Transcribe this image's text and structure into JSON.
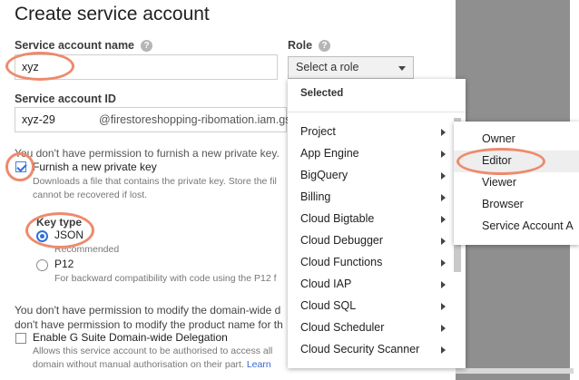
{
  "dialog": {
    "title": "Create service account",
    "service_account_name": {
      "label": "Service account name",
      "value": "xyz"
    },
    "role": {
      "label": "Role",
      "select_value": "Select a role"
    },
    "service_account_id": {
      "label": "Service account ID",
      "value": "xyz-29",
      "domain": "@firestoreshopping-ribomation.iam.gs"
    },
    "private_key_warning": "You don't have permission to furnish a new private key.",
    "furnish_key": {
      "label": "Furnish a new private key",
      "checked": true,
      "desc_line1": "Downloads a file that contains the private key. Store the fil",
      "desc_line2": "cannot be recovered if lost."
    },
    "key_type": {
      "label": "Key type",
      "json": {
        "label": "JSON",
        "sub": "Recommended",
        "checked": true
      },
      "p12": {
        "label": "P12",
        "sub": "For backward compatibility with code using the P12 f",
        "checked": false
      }
    },
    "domain_warning_line1": "You don't have permission to modify the domain-wide d",
    "domain_warning_line2": "don't have permission to modify the product name for th",
    "gsuite": {
      "label": "Enable G Suite Domain-wide Delegation",
      "checked": false,
      "desc_line1": "Allows this service account to be authorised to access all",
      "desc_line2": "domain without manual authorisation on their part.",
      "link": "Learn"
    }
  },
  "role_dropdown": {
    "header": "Selected",
    "items": [
      "Project",
      "App Engine",
      "BigQuery",
      "Billing",
      "Cloud Bigtable",
      "Cloud Debugger",
      "Cloud Functions",
      "Cloud IAP",
      "Cloud SQL",
      "Cloud Scheduler",
      "Cloud Security Scanner"
    ]
  },
  "project_submenu": {
    "items": [
      "Owner",
      "Editor",
      "Viewer",
      "Browser",
      "Service Account A"
    ],
    "hovered": "Editor"
  },
  "colors": {
    "accent": "#2f6fd8",
    "highlight_ring": "#ee8a6c",
    "backdrop": "#8f8f8f"
  }
}
